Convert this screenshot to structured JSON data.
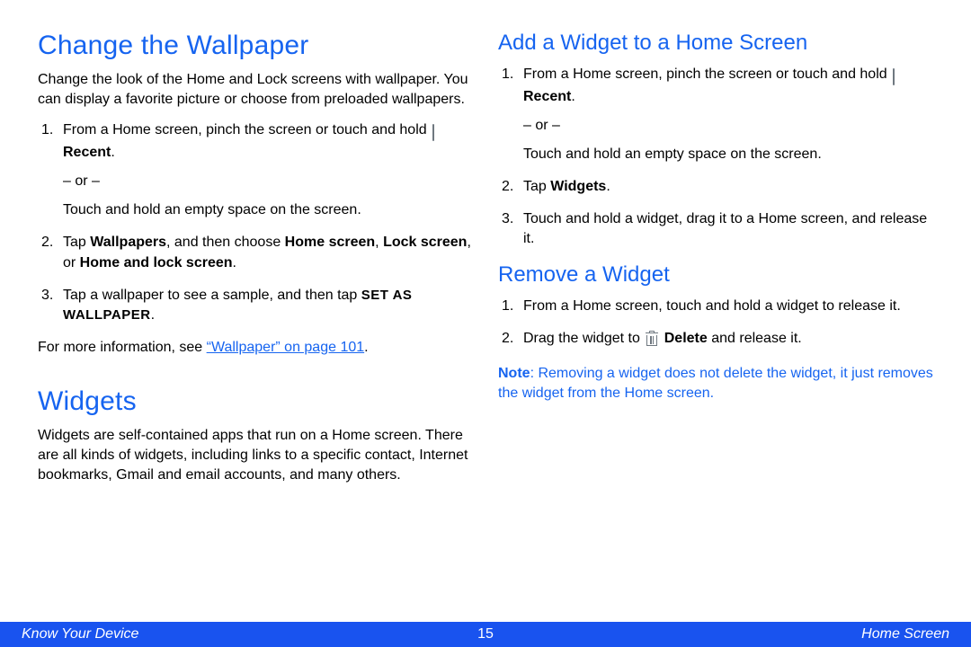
{
  "colors": {
    "accent": "#1664f0",
    "footer": "#1953ef"
  },
  "left": {
    "h1a": "Change the Wallpaper",
    "intro": "Change the look of the Home and Lock screens with wallpaper. You can display a favorite picture or choose from preloaded wallpapers.",
    "li1a": "From a Home screen, pinch the screen or touch and hold ",
    "recent": "Recent",
    "li1b": ".",
    "or": "– or –",
    "li1c": "Touch and hold an empty space on the screen.",
    "li2a": "Tap ",
    "wallpapers": "Wallpapers",
    "li2b": ", and then choose ",
    "hs": "Home screen",
    "li2c": ", ",
    "ls": "Lock screen",
    "li2d": ", or ",
    "hls": "Home and lock screen",
    "li2e": ".",
    "li3a": "Tap a wallpaper to see a sample, and then tap ",
    "setas": "SET AS WALLPAPER",
    "li3b": ".",
    "xref_pre": "For more information, see ",
    "xref": "“Wallpaper” on page 101",
    "xref_post": ".",
    "h1b": "Widgets",
    "widgets_body": "Widgets are self-contained apps that run on a Home screen. There are all kinds of widgets, including links to a specific contact, Internet bookmarks, Gmail and email accounts, and many others."
  },
  "right": {
    "h2a": "Add a Widget to a Home Screen",
    "a1a": "From a Home screen, pinch the screen or touch and hold ",
    "recent": "Recent",
    "a1b": ".",
    "or": "– or –",
    "a1c": "Touch and hold an empty space on the screen.",
    "a2a": "Tap ",
    "widgets": "Widgets",
    "a2b": ".",
    "a3": "Touch and hold a widget, drag it to a Home screen, and release it.",
    "h2b": "Remove a Widget",
    "r1": "From a Home screen, touch and hold a widget to release it.",
    "r2a": "Drag the widget to ",
    "delete": "Delete",
    "r2b": " and release it.",
    "note_label": "Note",
    "note_body": ": Removing a widget does not delete the widget, it just removes the widget from the Home screen."
  },
  "footer": {
    "left": "Know Your Device",
    "center": "15",
    "right": "Home Screen"
  }
}
